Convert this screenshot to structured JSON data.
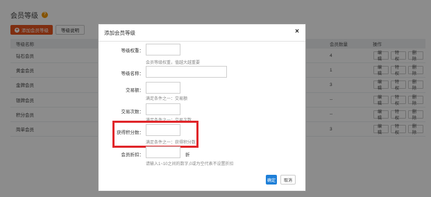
{
  "page": {
    "title": "会员等级",
    "add_button": "添加会员等级",
    "desc_button": "等级说明"
  },
  "table": {
    "headers": {
      "name": "等级名称",
      "count": "会员数量",
      "ops": "操作"
    },
    "rows": [
      {
        "name": "钻石会员",
        "count": "4"
      },
      {
        "name": "黄金会员",
        "count": "1"
      },
      {
        "name": "金牌会员",
        "count": "3"
      },
      {
        "name": "银牌会员",
        "count": "--"
      },
      {
        "name": "积分会员",
        "count": "--"
      },
      {
        "name": "简单会员",
        "count": "3"
      }
    ],
    "ops": {
      "edit": "编辑",
      "privilege": "特权",
      "delete": "删除"
    }
  },
  "dialog": {
    "title": "添加会员等级",
    "close": "×",
    "fields": {
      "weight_label": "等级权重：",
      "weight_hint": "会员等级权重，值越大越重要",
      "name_label": "等级名称：",
      "amount_label": "交易额：",
      "amount_hint": "满足条件之一：交易额",
      "times_label": "交易次数：",
      "times_hint": "满足条件之一：交易次数",
      "points_label": "获得积分数：",
      "points_hint": "满足条件之一：获得积分数",
      "discount_label": "会员折扣：",
      "discount_unit": "折",
      "discount_hint": "请输入1~10之间的数字,0或为空代表不设置折扣"
    },
    "ok": "确定",
    "cancel": "取消"
  },
  "colors": {
    "accent": "#e8541e",
    "primary": "#1e7fd8",
    "highlight": "#e0262a",
    "help": "#f39800"
  }
}
